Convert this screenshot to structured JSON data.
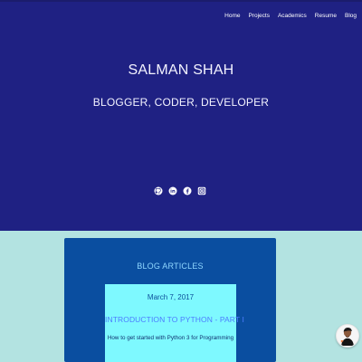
{
  "nav": {
    "items": [
      "Home",
      "Projects",
      "Academics",
      "Resume",
      "Blog"
    ]
  },
  "hero": {
    "name": "SALMAN SHAH",
    "tagline": "BLOGGER, CODER, DEVELOPER",
    "social_icons": [
      "github-icon",
      "linkedin-icon",
      "facebook-icon",
      "instagram-icon"
    ]
  },
  "blog": {
    "heading": "BLOG ARTICLES",
    "articles": [
      {
        "date": "March 7, 2017",
        "title": "INTRODUCTION TO PYTHON - PART I",
        "subtitle": "How to get started with Python 3 for Programming"
      }
    ]
  },
  "colors": {
    "hero_bg": "#1f2183",
    "page_bg": "#b3e3e1",
    "panel_bg": "#0a4ea0",
    "card_bg": "#7ef9ff",
    "title_blue": "#4c7cff",
    "heading_blue": "#8fd7ff"
  }
}
